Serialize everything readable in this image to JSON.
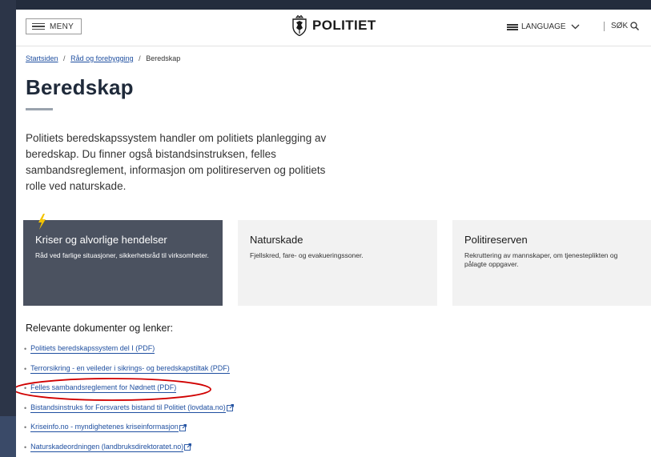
{
  "header": {
    "menu_label": "MENY",
    "logo_text": "POLITIET",
    "language_label": "LANGUAGE",
    "search_label": "SØK"
  },
  "breadcrumb": {
    "items": [
      "Startsiden",
      "Råd og forebygging"
    ],
    "current": "Beredskap"
  },
  "main": {
    "title": "Beredskap",
    "intro": "Politiets beredskapssystem handler om politiets planlegging av beredskap. Du finner også bistandsinstruksen, felles sambandsreglement, informasjon om politireserven og politiets rolle ved naturskade."
  },
  "cards": [
    {
      "title": "Kriser og alvorlige hendelser",
      "text": "Råd ved farlige situasjoner, sikkerhetsråd til virksomheter."
    },
    {
      "title": "Naturskade",
      "text": "Fjellskred, fare- og evakueringssoner."
    },
    {
      "title": "Politireserven",
      "text": "Rekruttering av mannskaper, om tjenesteplikten og pålagte oppgaver."
    }
  ],
  "links": {
    "heading": "Relevante dokumenter og lenker:",
    "items": [
      {
        "label": "Politiets beredskapssystem del I (PDF)",
        "external": false
      },
      {
        "label": "Terrorsikring - en veileder i sikrings- og beredskapstiltak (PDF)",
        "external": false
      },
      {
        "label": "Felles sambandsreglement for Nødnett (PDF)",
        "external": false
      },
      {
        "label": "Bistandsinstruks for Forsvarets bistand til Politiet (lovdata.no)",
        "external": true
      },
      {
        "label": "Kriseinfo.no - myndighetenes kriseinformasjon",
        "external": true
      },
      {
        "label": "Naturskadeordningen (landbruksdirektoratet.no)",
        "external": true
      }
    ]
  },
  "colors": {
    "link": "#1f4fa0",
    "dark_card": "#4b5260",
    "light_card": "#f2f2f2",
    "accent_bolt": "#f3c300",
    "annotation_circle": "#d00000"
  },
  "icons": [
    "hamburger-icon",
    "coat-of-arms-icon",
    "flag-icon",
    "chevron-down-icon",
    "search-icon",
    "lightning-bolt-icon",
    "external-link-icon"
  ]
}
